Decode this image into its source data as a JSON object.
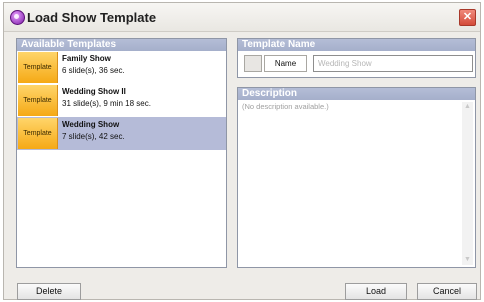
{
  "window": {
    "title": "Load Show Template",
    "close_symbol": "✕"
  },
  "icons": {
    "app": "app-logo-icon",
    "close": "close-icon",
    "scroll_up": "scroll-up-icon",
    "scroll_down": "scroll-down-icon"
  },
  "templates_panel": {
    "header": "Available Templates",
    "items": [
      {
        "thumb": "Template",
        "name": "Family Show",
        "detail": "6 slide(s), 36 sec.",
        "selected": false
      },
      {
        "thumb": "Template",
        "name": "Wedding Show II",
        "detail": "31 slide(s), 9 min 18 sec.",
        "selected": false
      },
      {
        "thumb": "Template",
        "name": "Wedding Show",
        "detail": "7 slide(s), 42 sec.",
        "selected": true
      }
    ]
  },
  "name_panel": {
    "header": "Template Name",
    "label": "Name",
    "placeholder": "Wedding Show"
  },
  "description_panel": {
    "header": "Description",
    "text": "(No description available.)"
  },
  "buttons": {
    "delete": "Delete",
    "load": "Load",
    "cancel": "Cancel"
  },
  "colors": {
    "header_blue": "#a5afcb",
    "selection": "#b5bbd8",
    "template_thumb": "#f5a915"
  }
}
